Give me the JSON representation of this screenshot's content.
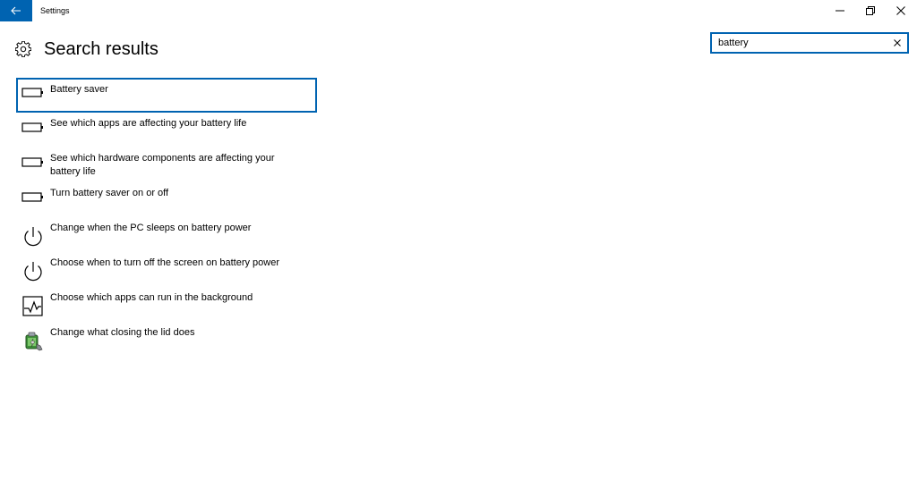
{
  "window": {
    "title": "Settings",
    "back_icon": "back-arrow-icon",
    "minimize_icon": "minimize-icon",
    "restore_icon": "restore-icon",
    "close_icon": "close-icon",
    "accent": "#0063b1"
  },
  "header": {
    "icon": "gear-icon",
    "title": "Search results"
  },
  "search": {
    "value": "battery",
    "placeholder": "",
    "clear_icon": "clear-icon"
  },
  "results": [
    {
      "label": "Battery saver",
      "icon": "battery-icon",
      "selected": true
    },
    {
      "label": "See which apps are affecting your battery life",
      "icon": "battery-icon",
      "selected": false
    },
    {
      "label": "See which hardware components are affecting your battery life",
      "icon": "battery-icon",
      "selected": false
    },
    {
      "label": "Turn battery saver on or off",
      "icon": "battery-icon",
      "selected": false
    },
    {
      "label": "Change when the PC sleeps on battery power",
      "icon": "power-icon",
      "selected": false
    },
    {
      "label": "Choose when to turn off the screen on battery power",
      "icon": "power-icon",
      "selected": false
    },
    {
      "label": "Choose which apps can run in the background",
      "icon": "activity-monitor-icon",
      "selected": false
    },
    {
      "label": "Change what closing the lid does",
      "icon": "power-options-icon",
      "selected": false
    }
  ]
}
